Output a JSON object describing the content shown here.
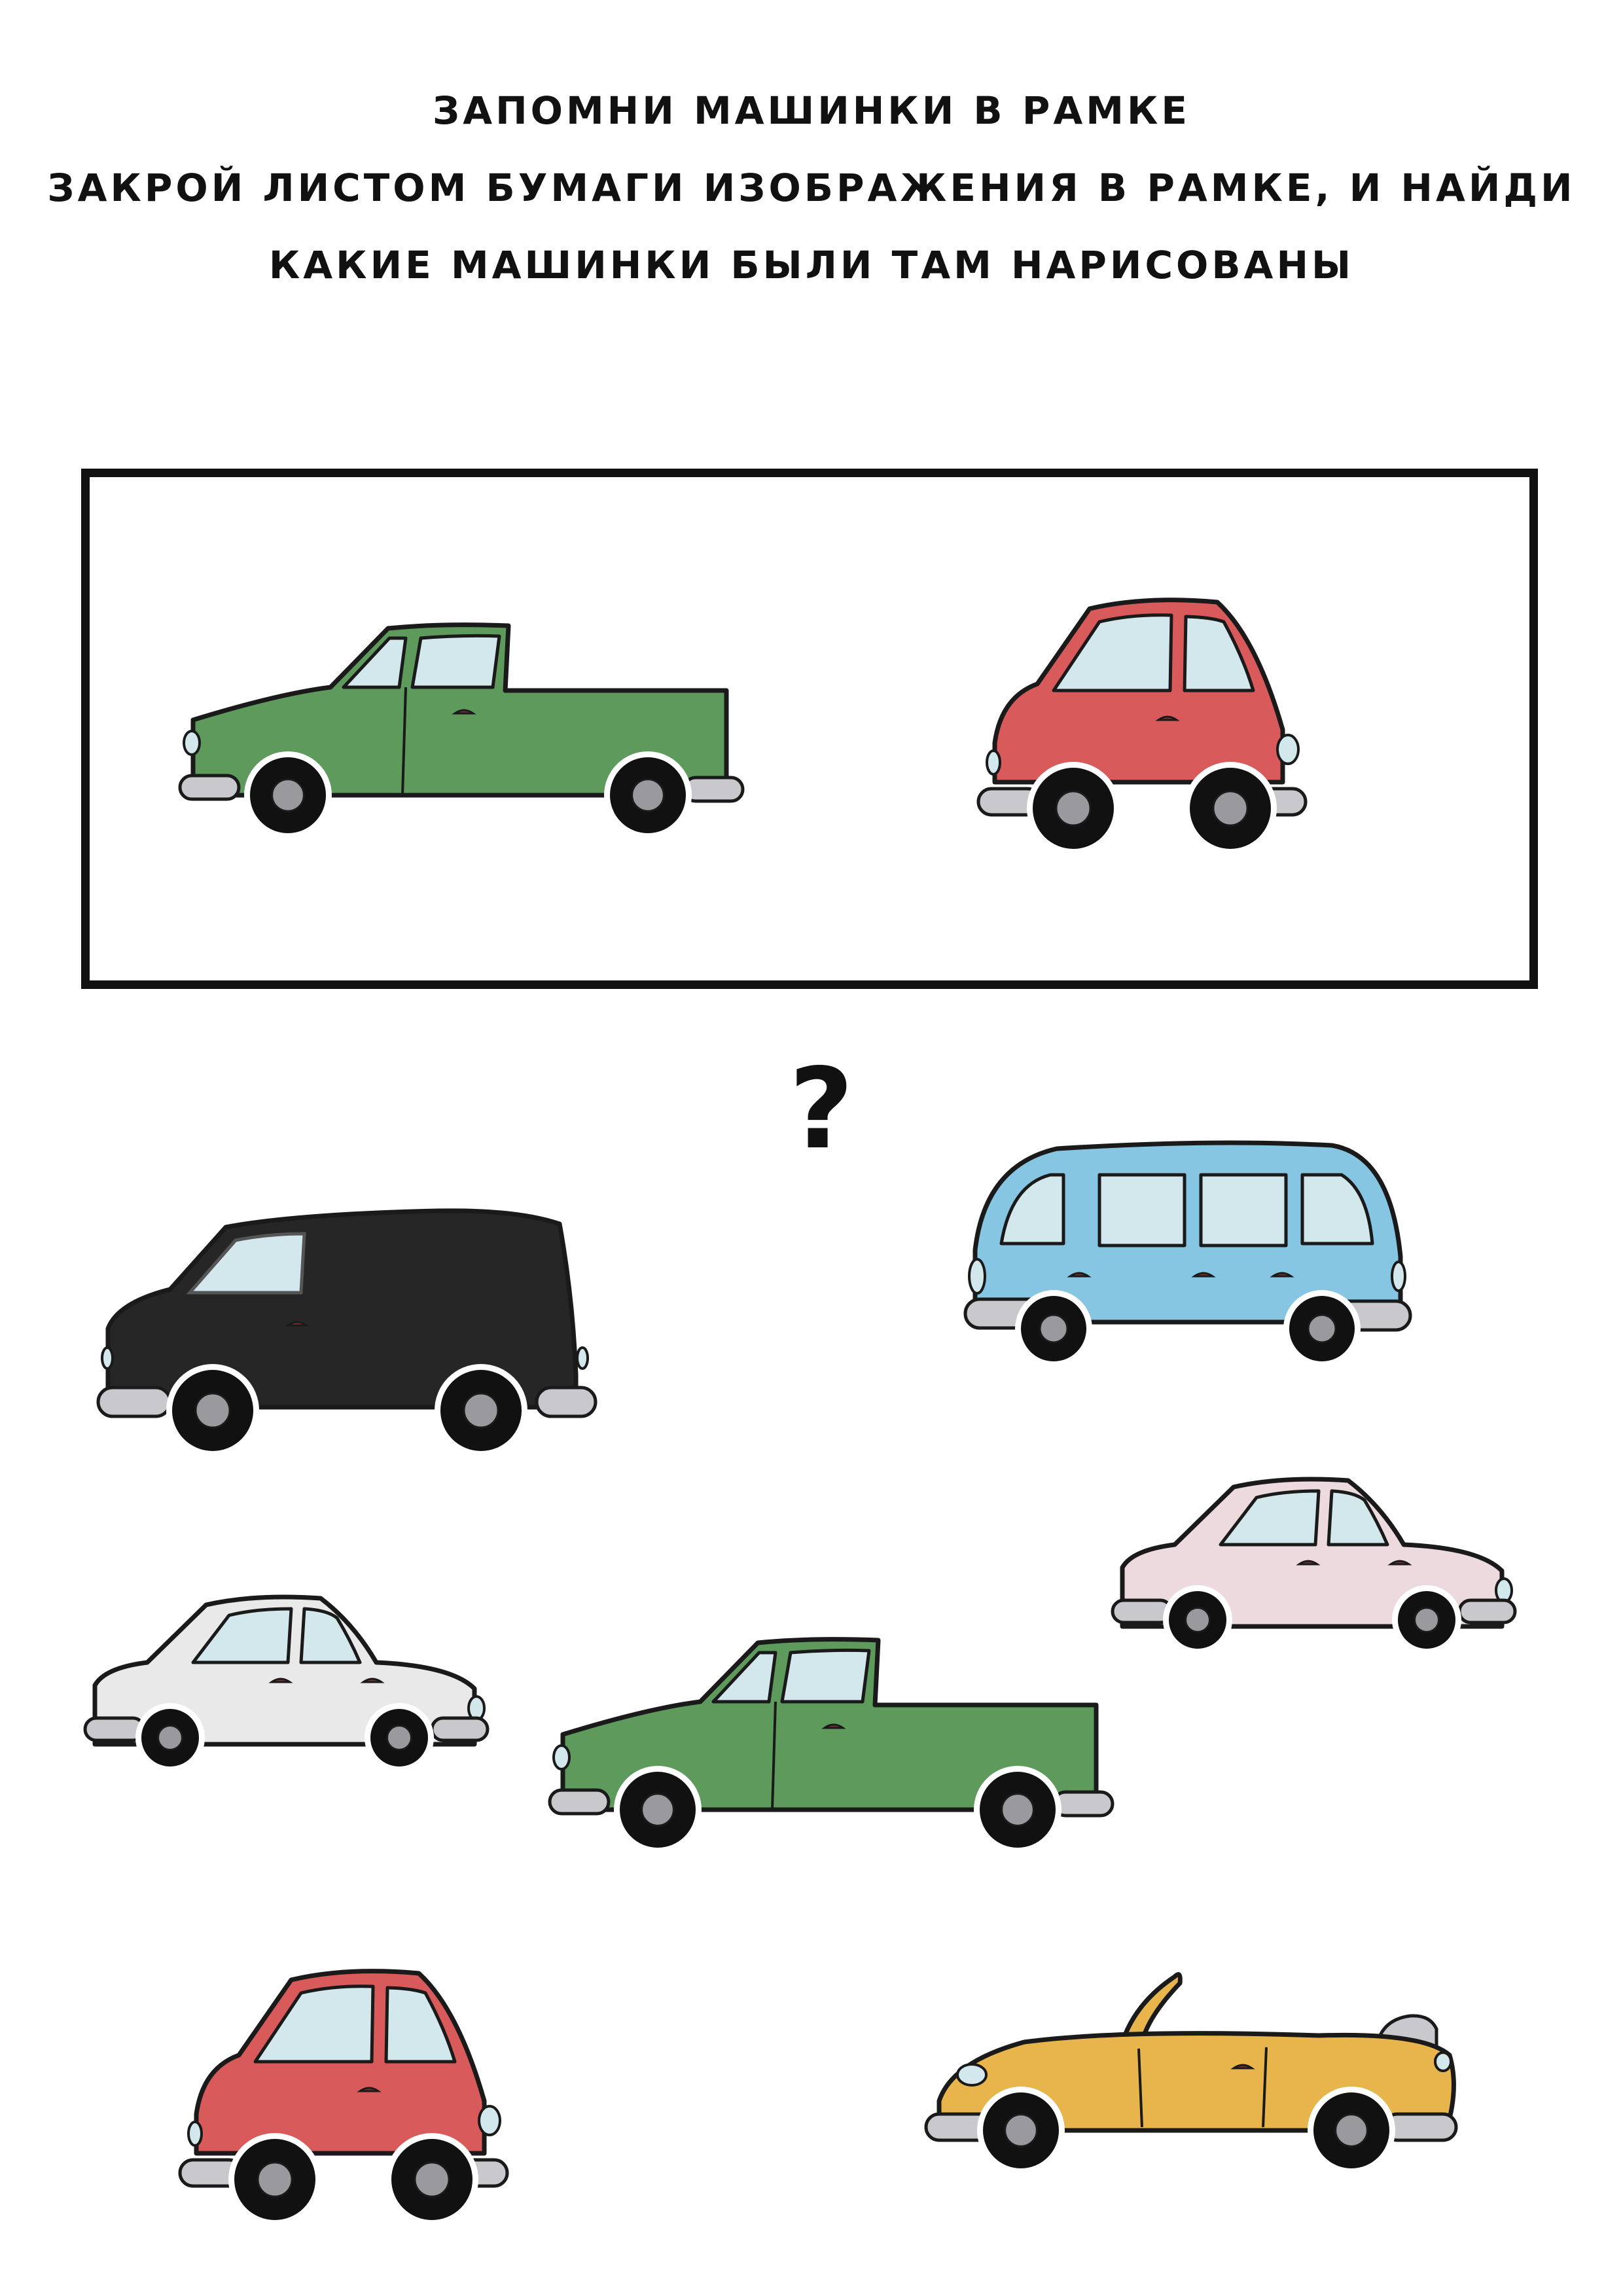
{
  "instructions": [
    "ЗАПОМНИ МАШИНКИ В РАМКЕ",
    "ЗАКРОЙ ЛИСТОМ БУМАГИ ИЗОБРАЖЕНИЯ В РАМКЕ, И НАЙДИ",
    "КАКИЕ МАШИНКИ БЫЛИ ТАМ НАРИСОВАНЫ"
  ],
  "question_mark": "?",
  "colors": {
    "outline": "#1a1a1a",
    "window": "#d3e8ec",
    "bumper": "#c9c9cd",
    "tire": "#111111",
    "hub": "#9a9a9e",
    "green": "#5d9a5c",
    "red": "#d85a5a",
    "black": "#262626",
    "blue": "#86c6e2",
    "pink": "#eddadf",
    "white": "#e9e9e9",
    "yellow": "#e7b54c"
  },
  "framed_cars": [
    {
      "kind": "pickup",
      "color": "green",
      "icon": "green-pickup-truck-icon"
    },
    {
      "kind": "compact",
      "color": "red",
      "icon": "red-compact-car-icon"
    }
  ],
  "choice_cars": [
    {
      "kind": "van",
      "color": "black",
      "icon": "black-van-icon"
    },
    {
      "kind": "minibus",
      "color": "blue",
      "icon": "blue-minibus-icon"
    },
    {
      "kind": "sedan",
      "color": "pink",
      "icon": "pink-sedan-icon"
    },
    {
      "kind": "sedan",
      "color": "white",
      "icon": "white-sedan-icon"
    },
    {
      "kind": "pickup",
      "color": "green",
      "icon": "green-pickup-truck-icon"
    },
    {
      "kind": "compact",
      "color": "red",
      "icon": "red-compact-car-icon"
    },
    {
      "kind": "convertible",
      "color": "yellow",
      "icon": "yellow-convertible-icon"
    }
  ]
}
